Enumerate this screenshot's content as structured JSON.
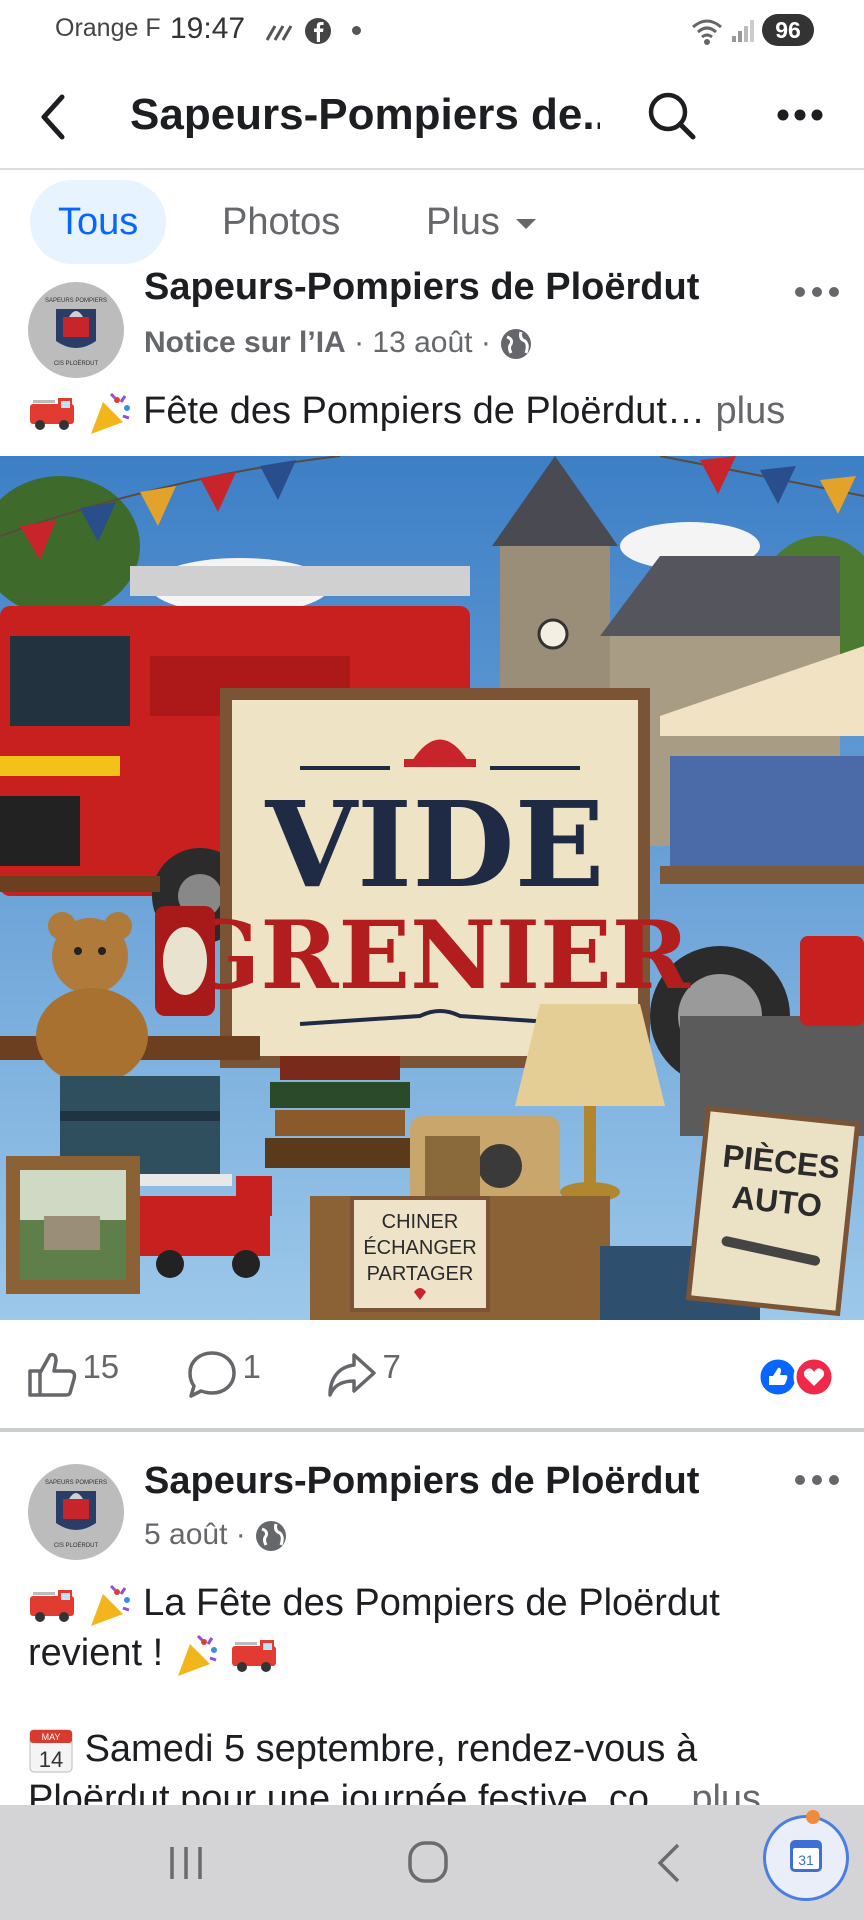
{
  "status_bar": {
    "carrier": "Orange F",
    "time": "19:47",
    "battery": "96"
  },
  "header": {
    "title": "Sapeurs-Pompiers de..."
  },
  "tabs": [
    {
      "label": "Tous"
    },
    {
      "label": "Photos"
    },
    {
      "label": "Plus"
    }
  ],
  "post1": {
    "author": "Sapeurs-Pompiers de Ploërdut",
    "ai_notice": "Notice sur l’IA",
    "date": "13 août",
    "text": "Fête des Pompiers de Ploërdut…",
    "more": "plus",
    "image": {
      "sign_line1": "VIDE",
      "sign_line2": "GRENIER",
      "small_sign": [
        "CHINER",
        "ÉCHANGER",
        "PARTAGER"
      ],
      "parts_sign": [
        "PIÈCES",
        "AUTO"
      ]
    },
    "likes": "15",
    "comments": "1",
    "shares": "7"
  },
  "post2": {
    "author": "Sapeurs-Pompiers de Ploërdut",
    "date": "5 août",
    "text_line1": "La Fête des Pompiers de Ploërdut",
    "text_line2": "revient !",
    "text_line3": "Samedi 5 septembre, rendez-vous à",
    "text_line4": "Ploërdut pour une journée festive, co...",
    "more": "plus",
    "calendar_month": "MAY",
    "calendar_day": "14"
  },
  "avatar_text": {
    "top": "SAPEURS POMPIERS",
    "bottom": "CIS PLOËRDUT"
  },
  "fab_day": "31",
  "colors": {
    "facebook_blue": "#0866ff",
    "tab_active_bg": "#e7f3ff",
    "love_red": "#f0284a"
  }
}
